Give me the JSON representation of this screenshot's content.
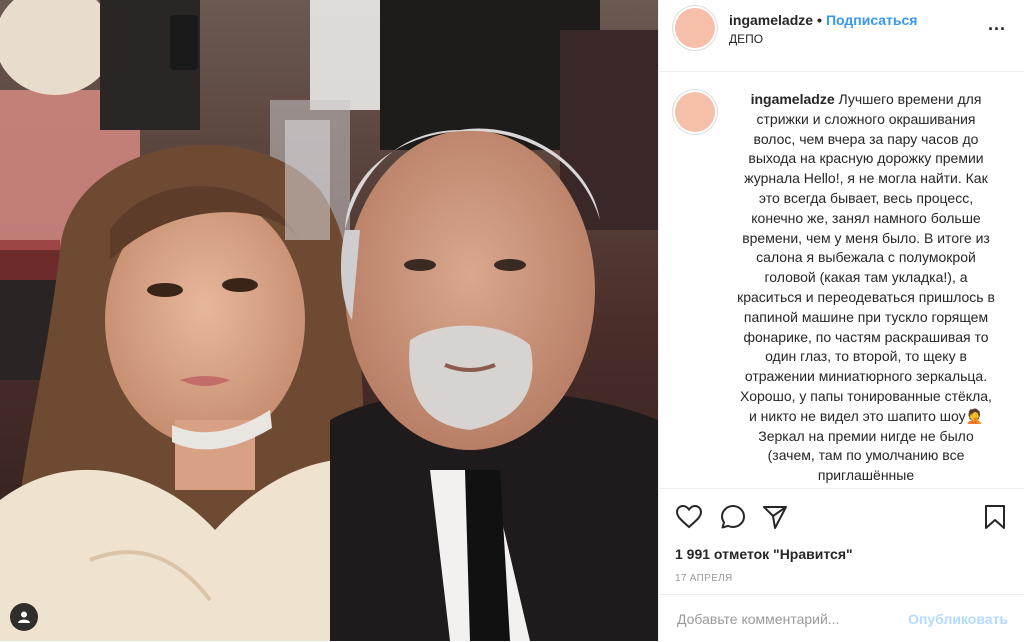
{
  "post": {
    "photo_alt": "",
    "tagged_icon": "tagged-user-icon"
  },
  "header": {
    "username": "ingameladze",
    "separator": "•",
    "follow_label": "Подписаться",
    "location": "ДЕПО",
    "more": "..."
  },
  "caption": {
    "username": "ingameladze",
    "text": "Лучшего времени для стрижки и сложного окрашивания волос, чем вчера за пару часов до выхода на красную дорожку премии журнала Hello!, я не могла найти. Как это всегда бывает, весь процесс, конечно же, занял намного больше времени, чем у меня было. В итоге из салона я выбежала с полумокрой головой (какая там укладка!), а краситься и переодеваться пришлось в папиной машине при тускло горящем фонарике, по частям раскрашивая то один глаз, то второй, то щеку в отражении миниатюрного зеркальца. Хорошо, у папы тонированные стёкла, и никто не видел это шапито шоу🤦 Зеркал на премии нигде не было (зачем, там по умолчанию все приглашённые"
  },
  "actions": {
    "like_icon": "heart-icon",
    "comment_icon": "comment-icon",
    "share_icon": "share-icon",
    "save_icon": "bookmark-icon"
  },
  "likes": "1 991 отметок \"Нравится\"",
  "date": "17 апреля",
  "comment": {
    "placeholder": "Добавьте комментарий...",
    "publish_label": "Опубликовать"
  },
  "colors": {
    "accent": "#3897f0",
    "publish_disabled": "#b3dbff",
    "avatar": "#f5bfa9"
  }
}
